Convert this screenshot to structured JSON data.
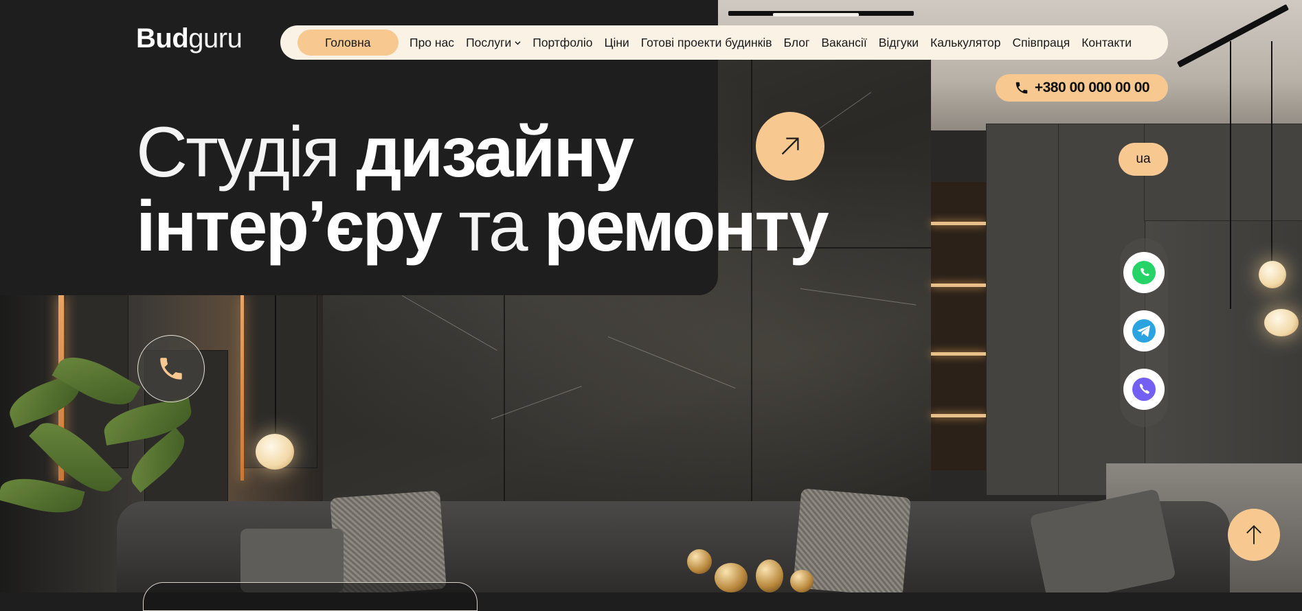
{
  "logo": {
    "bold": "Bud",
    "light": "guru"
  },
  "nav": {
    "items": [
      {
        "label": "Головна",
        "active": true
      },
      {
        "label": "Про нас"
      },
      {
        "label": "Послуги",
        "has_dropdown": true
      },
      {
        "label": "Портфоліо"
      },
      {
        "label": "Ціни"
      },
      {
        "label": "Готові проекти будинків"
      },
      {
        "label": "Блог"
      },
      {
        "label": "Вакансії"
      },
      {
        "label": "Відгуки"
      },
      {
        "label": "Калькулятор"
      },
      {
        "label": "Співпраця"
      },
      {
        "label": "Контакти"
      }
    ]
  },
  "phone": {
    "number": "+380 00 000 00 00",
    "icon": "phone-icon"
  },
  "language": {
    "current": "ua"
  },
  "hero": {
    "line1_thin": "Студія ",
    "line1_bold": "дизайну",
    "line2_bold_a": "інтер’єру",
    "line2_thin": " та ",
    "line2_bold_b": "ремонту"
  },
  "messengers": [
    {
      "name": "whatsapp",
      "icon": "whatsapp-icon",
      "color": "#25d366"
    },
    {
      "name": "telegram",
      "icon": "telegram-icon",
      "color": "#2aa3e0"
    },
    {
      "name": "viber",
      "icon": "viber-icon",
      "color": "#7360f2"
    }
  ],
  "colors": {
    "accent": "#f7c890",
    "dark": "#1e1e1e",
    "nav_bg": "#fbf2e6"
  },
  "icons": {
    "arrow": "arrow-up-right-icon",
    "call": "phone-icon",
    "scroll_top": "arrow-up-icon"
  }
}
